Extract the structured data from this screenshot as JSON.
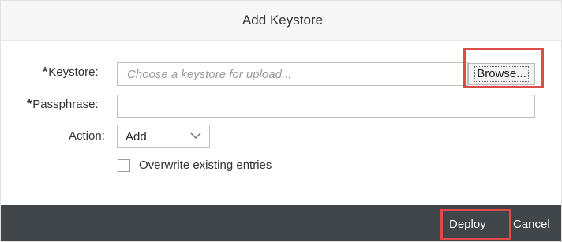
{
  "dialog": {
    "title": "Add Keystore"
  },
  "form": {
    "keystore": {
      "required_mark": "*",
      "label": "Keystore:",
      "placeholder": "Choose a keystore for upload...",
      "browse_label": "Browse..."
    },
    "passphrase": {
      "required_mark": "*",
      "label": "Passphrase:",
      "value": ""
    },
    "action": {
      "label": "Action:",
      "selected": "Add"
    },
    "overwrite": {
      "label": "Overwrite existing entries",
      "checked": false
    }
  },
  "footer": {
    "deploy_label": "Deploy",
    "cancel_label": "Cancel"
  },
  "colors": {
    "footer_bg": "#3f4548",
    "highlight": "#e04a4a",
    "header_bg": "#f7f7f7"
  },
  "icons": {
    "select_arrow": "chevron-down-icon",
    "checkbox": "checkbox-icon"
  }
}
